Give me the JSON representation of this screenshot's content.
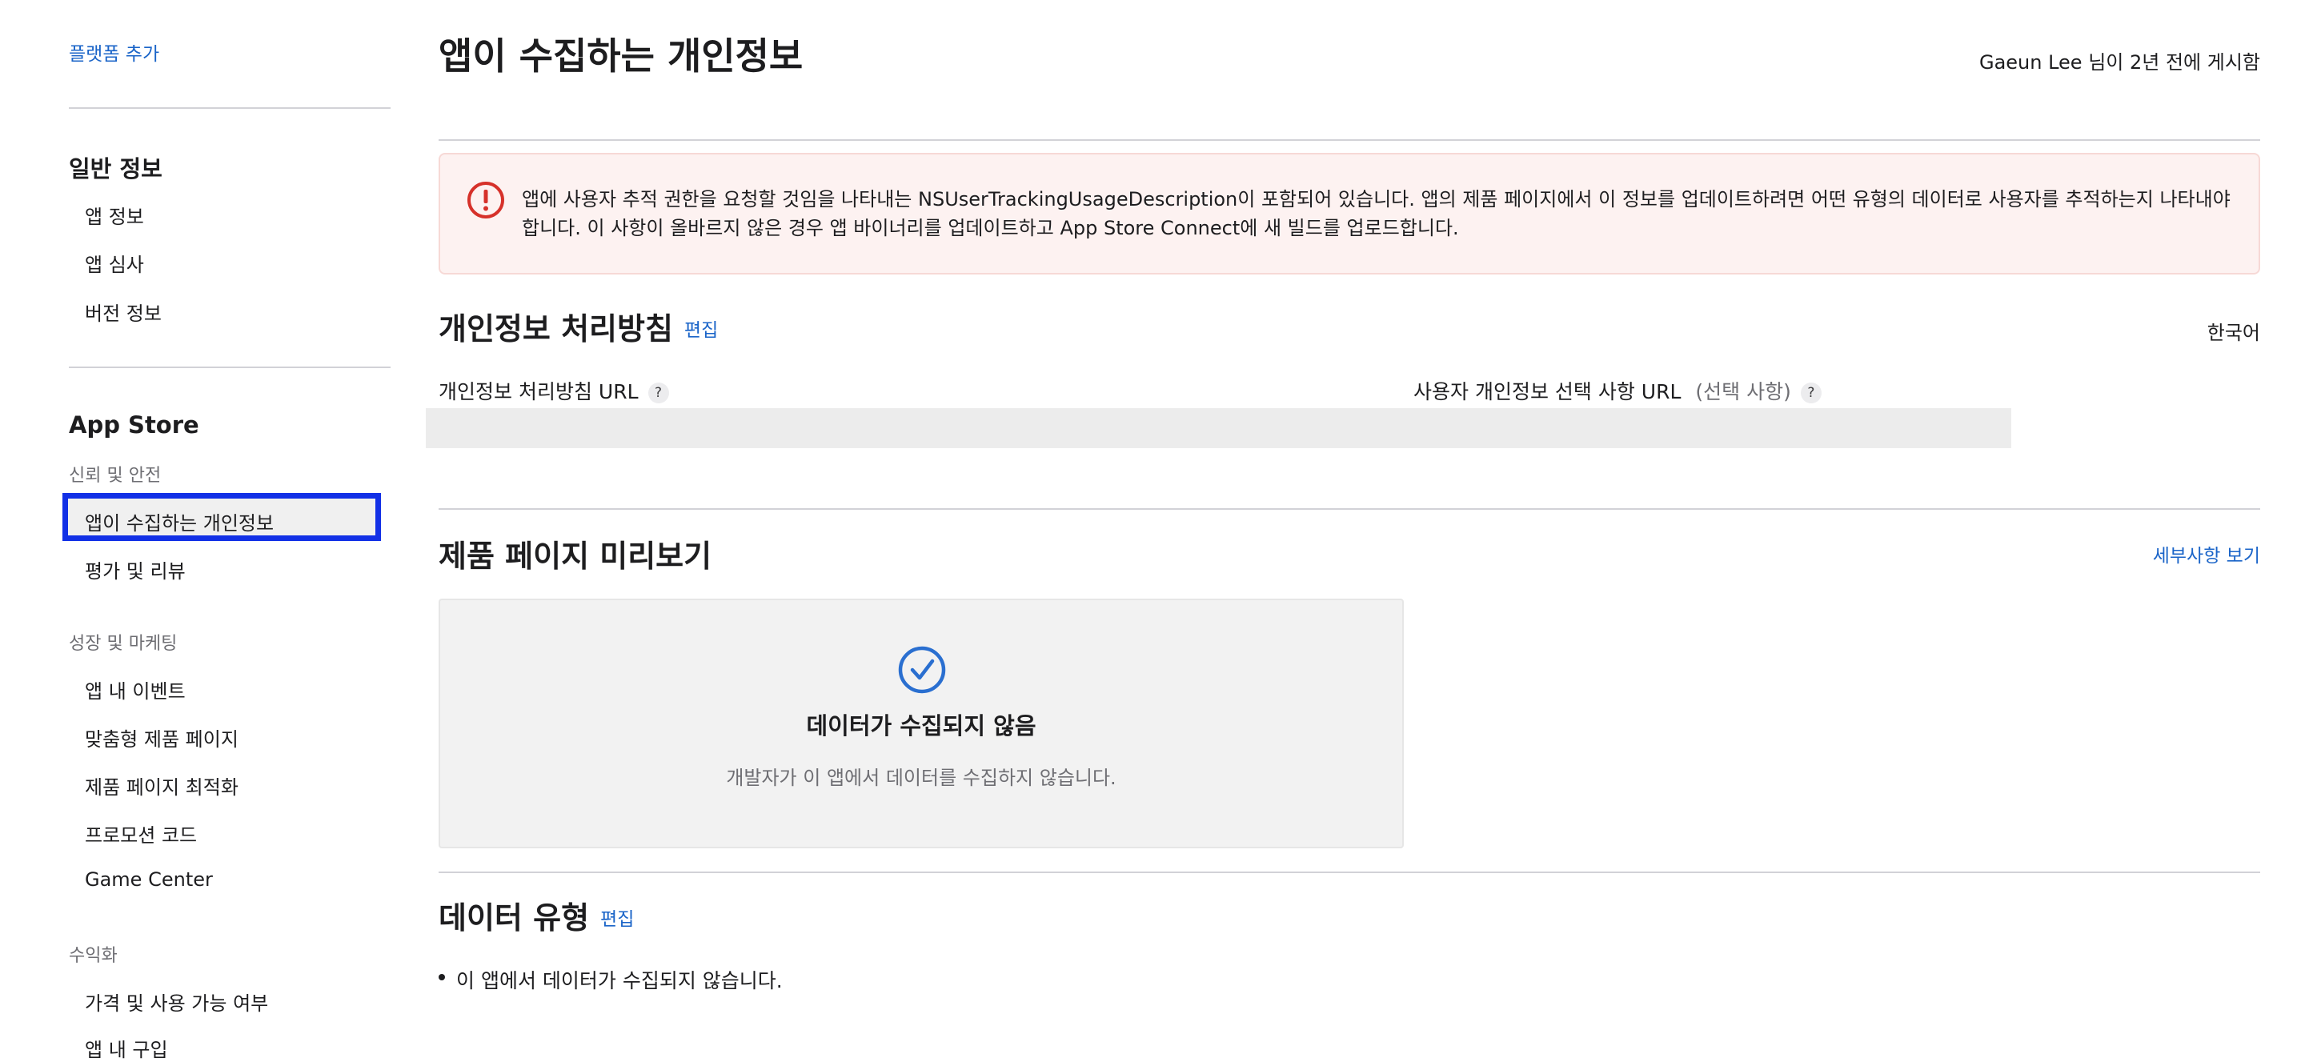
{
  "sidebar": {
    "add_platform": "플랫폼 추가",
    "general": {
      "heading": "일반 정보",
      "items": [
        "앱 정보",
        "앱 심사",
        "버전 정보"
      ]
    },
    "app_store": {
      "heading": "App Store",
      "trust_group": "신뢰 및 안전",
      "trust_items": [
        "앱이 수집하는 개인정보",
        "평가 및 리뷰"
      ],
      "selected_item": "앱이 수집하는 개인정보",
      "growth_group": "성장 및 마케팅",
      "growth_items": [
        "앱 내 이벤트",
        "맞춤형 제품 페이지",
        "제품 페이지 최적화",
        "프로모션 코드",
        "Game Center"
      ],
      "monetize_group": "수익화",
      "monetize_items": [
        "가격 및 사용 가능 여부",
        "앱 내 구입"
      ]
    }
  },
  "header": {
    "title": "앱이 수집하는 개인정보",
    "posted_by": "Gaeun Lee 님이 2년 전에 게시함"
  },
  "alert": {
    "icon": "exclamation-circle-icon",
    "color": "#d6312a",
    "text": "앱에 사용자 추적 권한을 요청할 것임을 나타내는 NSUserTrackingUsageDescription이 포함되어 있습니다. 앱의 제품 페이지에서 이 정보를 업데이트하려면 어떤 유형의 데이터로 사용자를 추적하는지 나타내야 합니다. 이 사항이 올바르지 않은 경우 앱 바이너리를 업데이트하고 App Store Connect에 새 빌드를 업로드합니다."
  },
  "privacy_policy": {
    "title": "개인정보 처리방침",
    "edit": "편집",
    "language": "한국어",
    "policy_url_label": "개인정보 처리방침 URL",
    "choices_url_label": "사용자 개인정보 선택 사항 URL",
    "optional": "(선택 사항)",
    "help": "?",
    "policy_url_value": "",
    "choices_url_value": ""
  },
  "preview": {
    "title": "제품 페이지 미리보기",
    "details_link": "세부사항 보기",
    "card_icon": "checkmark-circle-icon",
    "card_title": "데이터가 수집되지 않음",
    "card_desc": "개발자가 이 앱에서 데이터를 수집하지 않습니다."
  },
  "data_types": {
    "title": "데이터 유형",
    "edit": "편집",
    "items": [
      "이 앱에서 데이터가 수집되지 않습니다."
    ]
  },
  "colors": {
    "link": "#1a64c8",
    "selection_border": "#1230e6",
    "alert_background": "#fdf2f1",
    "check_icon": "#2a6fd0"
  }
}
